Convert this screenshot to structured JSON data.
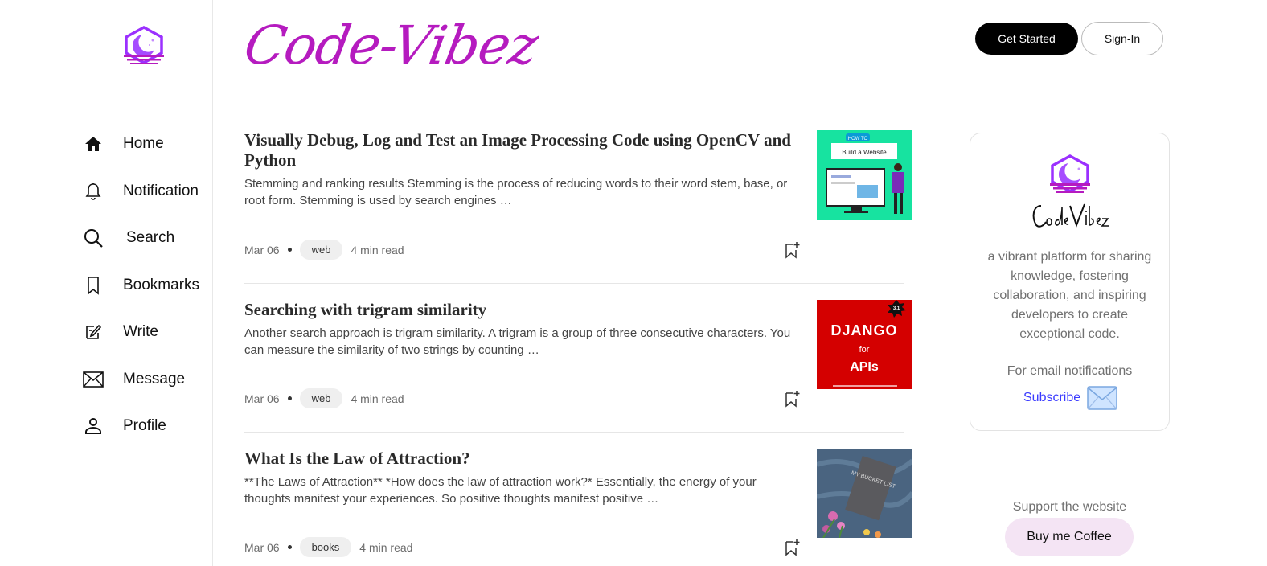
{
  "brand": {
    "name": "Code-Vibez"
  },
  "sidebar": {
    "items": [
      {
        "label": "Home",
        "icon": "home-icon"
      },
      {
        "label": "Notification",
        "icon": "bell-icon"
      },
      {
        "label": "Search",
        "icon": "search-icon"
      },
      {
        "label": "Bookmarks",
        "icon": "bookmark-icon"
      },
      {
        "label": "Write",
        "icon": "write-icon"
      },
      {
        "label": "Message",
        "icon": "envelope-icon"
      },
      {
        "label": "Profile",
        "icon": "user-icon"
      }
    ]
  },
  "header": {
    "get_started": "Get Started",
    "sign_in": "Sign-In"
  },
  "articles": [
    {
      "title": "Visually Debug, Log and Test an Image Processing Code using OpenCV and Python",
      "excerpt": "Stemming and ranking results Stemming is the process of reducing words to their word stem, base, or root form. Stemming is used by search engines …",
      "date": "Mar 06",
      "tag": "web",
      "read_time": "4 min read",
      "thumb": {
        "badge": "HOW TO",
        "caption": "Build a Website"
      }
    },
    {
      "title": "Searching with trigram similarity",
      "excerpt": "Another search approach is trigram similarity. A trigram is a group of three consecutive characters. You can measure the similarity of two strings by counting …",
      "date": "Mar 06",
      "tag": "web",
      "read_time": "4 min read",
      "thumb": {
        "line1": "DJANGO",
        "line2": "for",
        "line3": "APIs",
        "badge": "3.1"
      }
    },
    {
      "title": "What Is the Law of Attraction?",
      "excerpt": "**The Laws of Attraction** *How does the law of attraction work?* Essentially, the energy of your thoughts manifest your experiences. So positive thoughts manifest positive …",
      "date": "Mar 06",
      "tag": "books",
      "read_time": "4 min read",
      "thumb": {
        "book_text": "MY BUCKET LIST"
      }
    }
  ],
  "about_card": {
    "script_name": "CodeVibez",
    "description": "a vibrant platform for sharing knowledge, fostering collaboration, and inspiring developers to create exceptional code.",
    "email_label": "For email notifications",
    "subscribe_label": "Subscribe"
  },
  "support": {
    "label": "Support the website",
    "button": "Buy me Coffee"
  },
  "colors": {
    "brand": "#b51bbf",
    "accent_purple": "#9b30ff",
    "link": "#3b3bff"
  }
}
